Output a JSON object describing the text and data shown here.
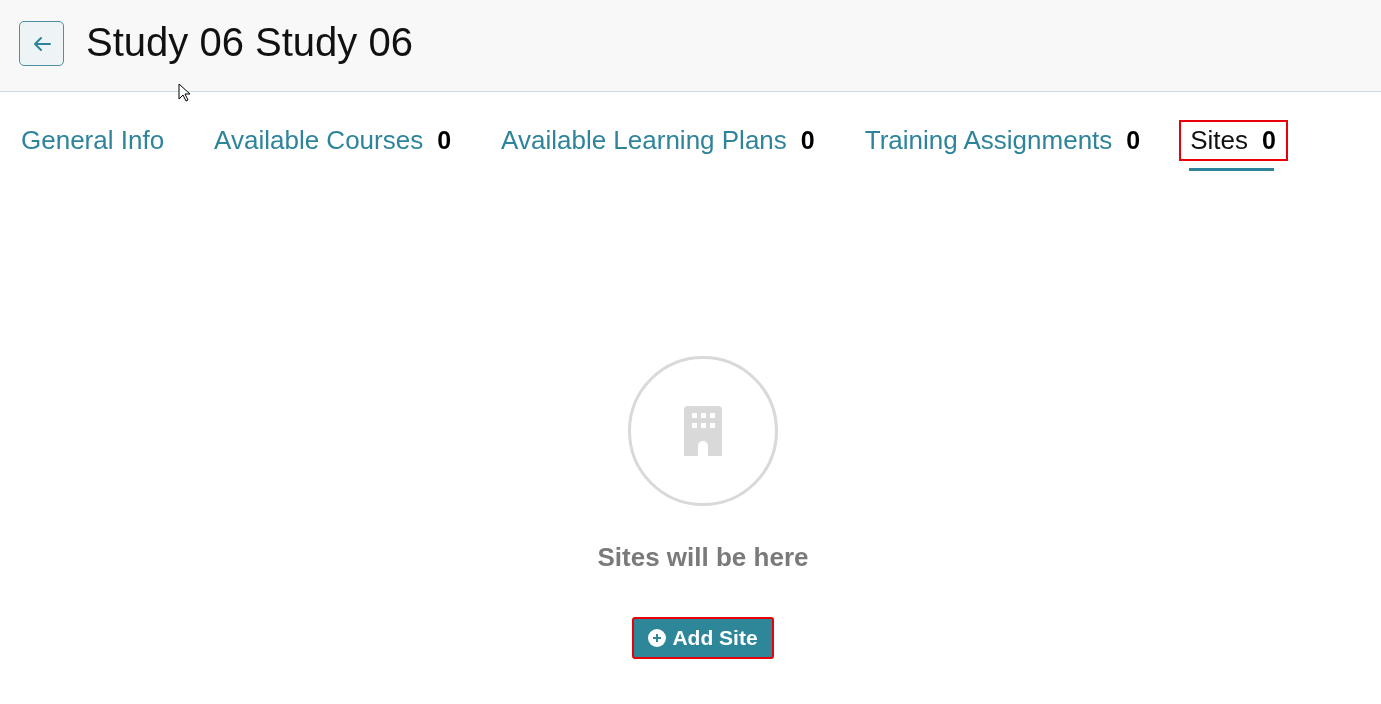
{
  "header": {
    "title": "Study 06 Study 06"
  },
  "tabs": [
    {
      "label": "General Info",
      "selected": false,
      "highlighted": false
    },
    {
      "label": "Available Courses",
      "count": "0",
      "selected": false,
      "highlighted": false
    },
    {
      "label": "Available Learning Plans",
      "count": "0",
      "selected": false,
      "highlighted": false
    },
    {
      "label": "Training Assignments",
      "count": "0",
      "selected": false,
      "highlighted": false
    },
    {
      "label": "Sites",
      "count": "0",
      "selected": true,
      "highlighted": true
    }
  ],
  "empty_state": {
    "message": "Sites will be here",
    "button": {
      "label": "Add Site",
      "highlighted": true
    }
  }
}
